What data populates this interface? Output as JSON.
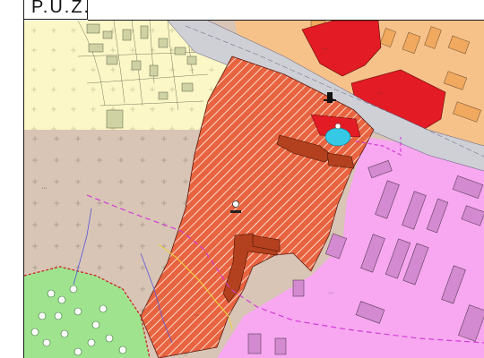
{
  "document": {
    "title": "P.U.Z."
  },
  "map": {
    "colors": {
      "proposed_zone": "#e8633f",
      "hatch": "#ffffff",
      "housing_yellow": "#fbf7c6",
      "agricultural_tan": "#d8c5b5",
      "industrial_pink": "#f7a8f0",
      "services_orange": "#f6c28a",
      "public_red": "#e21b24",
      "green_area": "#9fe38f",
      "road_grey": "#cfcfd6",
      "boundary_magenta": "#d23bd6",
      "limit_purple": "#5a55d8",
      "water": "#35c9e6"
    }
  }
}
